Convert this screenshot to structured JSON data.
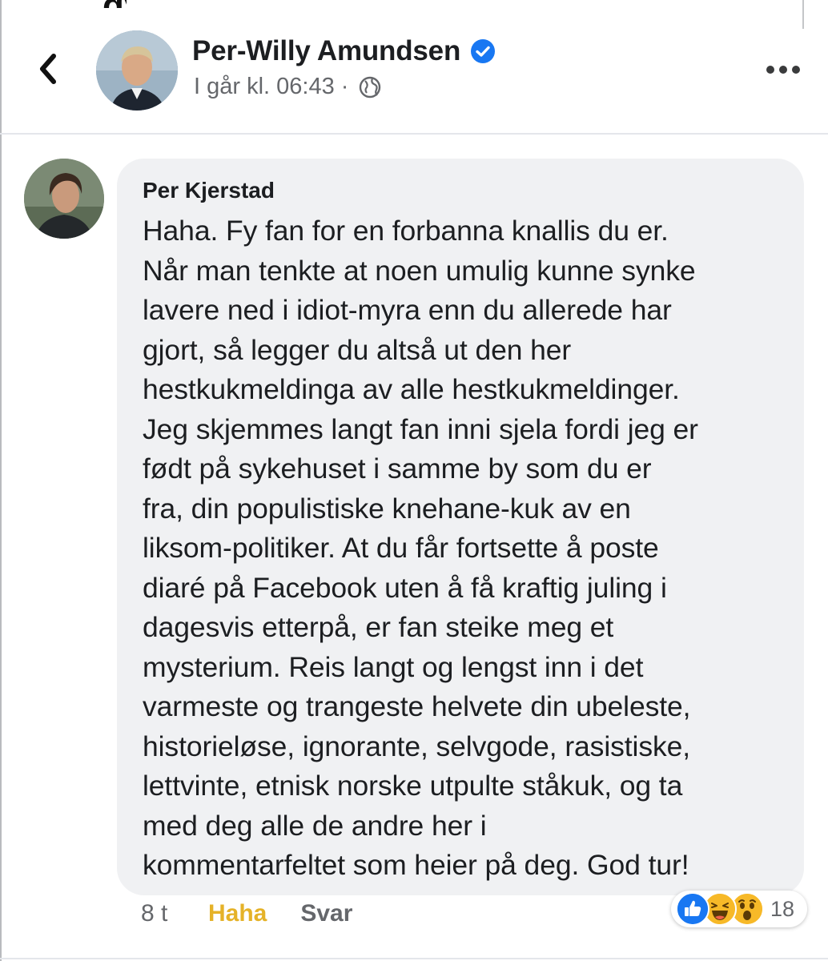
{
  "top_fragment": "gy",
  "post": {
    "author_name": "Per-Willy Amundsen",
    "timestamp": "I går kl. 06:43 ·",
    "icons": {
      "back": "chevron-left-icon",
      "verified": "verified-badge-icon",
      "audience": "globe-icon",
      "more": "more-options-icon"
    }
  },
  "comment": {
    "author": "Per Kjerstad",
    "lines": [
      "Haha. Fy fan for en forbanna knallis du er.",
      "Når man tenkte at noen umulig kunne synke",
      "lavere ned i idiot-myra enn du allerede har",
      "gjort, så legger du altså ut den her",
      "hestkukmeldinga av alle hestkukmeldinger.",
      "Jeg skjemmes langt fan inni sjela fordi jeg er",
      "født på sykehuset i samme by som du er",
      "fra, din populistiske knehane-kuk av en",
      "liksom-politiker. At du får fortsette å poste",
      "diaré på Facebook uten å få kraftig juling i",
      "dagesvis etterpå, er fan steike meg et",
      "mysterium. Reis langt og lengst inn i det",
      "varmeste og trangeste helvete din ubeleste,",
      "historieløse, ignorante, selvgode, rasistiske,",
      "lettvinte, etnisk norske utpulte ståkuk, og ta",
      "med deg alle de andre her i",
      "kommentarfeltet som heier på deg. God tur!"
    ],
    "time_ago": "8 t",
    "reaction_label": "Haha",
    "reply_label": "Svar",
    "reactions": {
      "icons": [
        "like-icon",
        "haha-emoji-icon",
        "wow-emoji-icon"
      ],
      "count": "18"
    }
  },
  "colors": {
    "link_blue": "#1877f2",
    "haha_gold": "#e5b228",
    "meta_gray": "#65676b",
    "bubble_bg": "#f0f1f3"
  }
}
